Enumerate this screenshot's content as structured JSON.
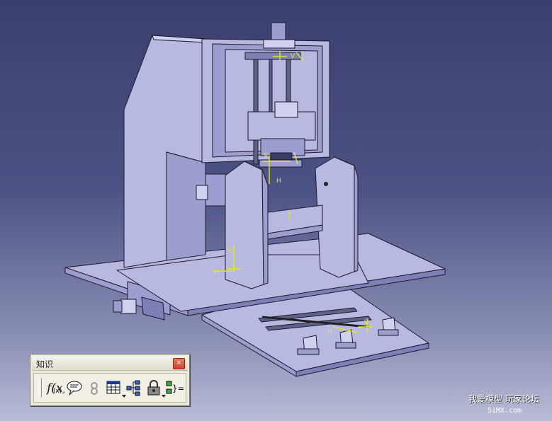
{
  "viewport": {
    "background_top": "#3a3f6e",
    "background_bottom": "#b9bcd6",
    "model_fill": "#b7b9e0",
    "annotation_color": "#e6e61a"
  },
  "toolbar": {
    "title": "知识",
    "close_label": "×",
    "buttons": [
      {
        "name": "formula-icon",
        "label": "f(x)"
      },
      {
        "name": "comment-icon"
      },
      {
        "name": "check-icon"
      },
      {
        "name": "table-icon"
      },
      {
        "name": "parameters-tree-icon"
      },
      {
        "name": "lock-icon"
      },
      {
        "name": "equivalent-dimensions-icon"
      }
    ]
  },
  "watermark": {
    "line1": "我爱模型 玩家论坛",
    "line2": "5iMX.com"
  }
}
